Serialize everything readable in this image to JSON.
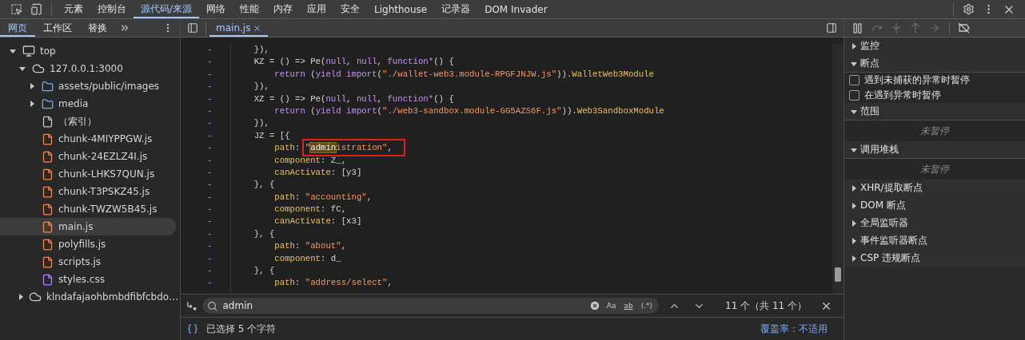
{
  "toolbar": {
    "tabs": [
      {
        "label": "元素",
        "selected": false
      },
      {
        "label": "控制台",
        "selected": false
      },
      {
        "label": "源代码/来源",
        "selected": true
      },
      {
        "label": "网络",
        "selected": false
      },
      {
        "label": "性能",
        "selected": false
      },
      {
        "label": "内存",
        "selected": false
      },
      {
        "label": "应用",
        "selected": false
      },
      {
        "label": "安全",
        "selected": false
      },
      {
        "label": "Lighthouse",
        "selected": false
      },
      {
        "label": "记录器",
        "selected": false
      },
      {
        "label": "DOM Invader",
        "selected": false
      }
    ]
  },
  "navigator": {
    "tabs": [
      {
        "label": "网页",
        "selected": true
      },
      {
        "label": "工作区",
        "selected": false
      },
      {
        "label": "替换",
        "selected": false
      }
    ],
    "tree": [
      {
        "label": "top",
        "kind": "frame",
        "expanded": true,
        "selected": false,
        "children": [
          {
            "label": "127.0.0.1:3000",
            "kind": "origin",
            "expanded": true,
            "selected": false,
            "children": [
              {
                "label": "assets/public/images",
                "kind": "folder",
                "expanded": false,
                "selected": false
              },
              {
                "label": "media",
                "kind": "folder",
                "expanded": false,
                "selected": false
              },
              {
                "label": "（索引）",
                "kind": "document",
                "selected": false
              },
              {
                "label": "chunk-4MIYPPGW.js",
                "kind": "script",
                "selected": false
              },
              {
                "label": "chunk-24EZLZ4I.js",
                "kind": "script",
                "selected": false
              },
              {
                "label": "chunk-LHKS7QUN.js",
                "kind": "script",
                "selected": false
              },
              {
                "label": "chunk-T3PSKZ45.js",
                "kind": "script",
                "selected": false
              },
              {
                "label": "chunk-TWZW5B45.js",
                "kind": "script",
                "selected": false
              },
              {
                "label": "main.js",
                "kind": "script",
                "selected": true
              },
              {
                "label": "polyfills.js",
                "kind": "script",
                "selected": false
              },
              {
                "label": "scripts.js",
                "kind": "script",
                "selected": false
              },
              {
                "label": "styles.css",
                "kind": "stylesheet",
                "selected": false
              }
            ]
          },
          {
            "label": "klndafajaohbmbdfibfcbdo…",
            "kind": "origin",
            "expanded": false,
            "selected": false
          }
        ]
      }
    ]
  },
  "editor": {
    "tabs": [
      {
        "label": "main.js",
        "selected": true
      }
    ],
    "lines": [
      {
        "gutter": "-",
        "tokens": [
          {
            "kind": "plain",
            "text": "    }),"
          }
        ]
      },
      {
        "gutter": "-",
        "tokens": [
          {
            "kind": "plain",
            "text": "    KZ = () => Pe("
          },
          {
            "kind": "keyword",
            "text": "null"
          },
          {
            "kind": "plain",
            "text": ", "
          },
          {
            "kind": "keyword",
            "text": "null"
          },
          {
            "kind": "plain",
            "text": ", "
          },
          {
            "kind": "keyword",
            "text": "function*"
          },
          {
            "kind": "plain",
            "text": "() {"
          }
        ]
      },
      {
        "gutter": "-",
        "tokens": [
          {
            "kind": "keyword",
            "text": "        return"
          },
          {
            "kind": "plain",
            "text": " ("
          },
          {
            "kind": "keyword",
            "text": "yield import"
          },
          {
            "kind": "plain",
            "text": "("
          },
          {
            "kind": "string",
            "text": "\"./wallet-web3.module-RPGFJNJW.js\""
          },
          {
            "kind": "plain",
            "text": "))."
          },
          {
            "kind": "property",
            "text": "WalletWeb3Module"
          }
        ]
      },
      {
        "gutter": "-",
        "tokens": [
          {
            "kind": "plain",
            "text": "    }),"
          }
        ]
      },
      {
        "gutter": "-",
        "tokens": [
          {
            "kind": "plain",
            "text": "    XZ = () => Pe("
          },
          {
            "kind": "keyword",
            "text": "null"
          },
          {
            "kind": "plain",
            "text": ", "
          },
          {
            "kind": "keyword",
            "text": "null"
          },
          {
            "kind": "plain",
            "text": ", "
          },
          {
            "kind": "keyword",
            "text": "function*"
          },
          {
            "kind": "plain",
            "text": "() {"
          }
        ]
      },
      {
        "gutter": "-",
        "tokens": [
          {
            "kind": "keyword",
            "text": "        return"
          },
          {
            "kind": "plain",
            "text": " ("
          },
          {
            "kind": "keyword",
            "text": "yield import"
          },
          {
            "kind": "plain",
            "text": "("
          },
          {
            "kind": "string",
            "text": "\"./web3-sandbox.module-GG5AZS6F.js\""
          },
          {
            "kind": "plain",
            "text": "))."
          },
          {
            "kind": "property",
            "text": "Web3SandboxModule"
          }
        ]
      },
      {
        "gutter": "-",
        "tokens": [
          {
            "kind": "plain",
            "text": "    }),"
          }
        ]
      },
      {
        "gutter": "-",
        "tokens": [
          {
            "kind": "plain",
            "text": "    JZ = [{"
          }
        ]
      },
      {
        "gutter": "-",
        "tokens": [
          {
            "kind": "property",
            "text": "        path"
          },
          {
            "kind": "plain",
            "text": ": "
          },
          {
            "kind": "string",
            "text": "\"",
            "boxed": true
          },
          {
            "kind": "match",
            "text": "admin",
            "boxed": true
          },
          {
            "kind": "string",
            "text": "istration\"",
            "boxed": true
          },
          {
            "kind": "plain",
            "text": ",",
            "boxed": true
          }
        ]
      },
      {
        "gutter": "-",
        "tokens": [
          {
            "kind": "property",
            "text": "        component"
          },
          {
            "kind": "plain",
            "text": ": Z_,"
          }
        ]
      },
      {
        "gutter": "-",
        "tokens": [
          {
            "kind": "property",
            "text": "        canActivate"
          },
          {
            "kind": "plain",
            "text": ": [y3]"
          }
        ]
      },
      {
        "gutter": "-",
        "tokens": [
          {
            "kind": "plain",
            "text": "    }, {"
          }
        ]
      },
      {
        "gutter": "-",
        "tokens": [
          {
            "kind": "property",
            "text": "        path"
          },
          {
            "kind": "plain",
            "text": ": "
          },
          {
            "kind": "string",
            "text": "\"accounting\""
          },
          {
            "kind": "plain",
            "text": ","
          }
        ]
      },
      {
        "gutter": "-",
        "tokens": [
          {
            "kind": "property",
            "text": "        component"
          },
          {
            "kind": "plain",
            "text": ": fC,"
          }
        ]
      },
      {
        "gutter": "-",
        "tokens": [
          {
            "kind": "property",
            "text": "        canActivate"
          },
          {
            "kind": "plain",
            "text": ": [x3]"
          }
        ]
      },
      {
        "gutter": "-",
        "tokens": [
          {
            "kind": "plain",
            "text": "    }, {"
          }
        ]
      },
      {
        "gutter": "-",
        "tokens": [
          {
            "kind": "property",
            "text": "        path"
          },
          {
            "kind": "plain",
            "text": ": "
          },
          {
            "kind": "string",
            "text": "\"about\""
          },
          {
            "kind": "plain",
            "text": ","
          }
        ]
      },
      {
        "gutter": "-",
        "tokens": [
          {
            "kind": "property",
            "text": "        component"
          },
          {
            "kind": "plain",
            "text": ": d_"
          }
        ]
      },
      {
        "gutter": "-",
        "tokens": [
          {
            "kind": "plain",
            "text": "    }, {"
          }
        ]
      },
      {
        "gutter": "-",
        "tokens": [
          {
            "kind": "property",
            "text": "        path"
          },
          {
            "kind": "plain",
            "text": ": "
          },
          {
            "kind": "string",
            "text": "\"address/select\""
          },
          {
            "kind": "plain",
            "text": ","
          }
        ]
      }
    ]
  },
  "search": {
    "value": "admin",
    "toggles": [
      {
        "label": "Aa",
        "selected": false
      },
      {
        "label": "ab",
        "selected": false
      },
      {
        "label": "(.*)",
        "selected": false
      }
    ],
    "count": "11 个（共 11 个）"
  },
  "status": {
    "selection": "已选择 5 个字符",
    "coverage": "覆盖率：不适用"
  },
  "debugger": {
    "sections": [
      {
        "title": "监控",
        "expanded": false
      },
      {
        "title": "断点",
        "expanded": true,
        "items": [
          {
            "kind": "checkbox",
            "label": "遇到未捕获的异常时暂停",
            "checked": false
          },
          {
            "kind": "checkbox",
            "label": "在遇到异常时暂停",
            "checked": false
          }
        ]
      },
      {
        "title": "范围",
        "expanded": true,
        "items": [
          {
            "kind": "empty",
            "label": "未暂停"
          }
        ]
      },
      {
        "title": "调用堆栈",
        "expanded": true,
        "items": [
          {
            "kind": "empty",
            "label": "未暂停"
          }
        ]
      },
      {
        "title": "XHR/提取断点",
        "expanded": false
      },
      {
        "title": "DOM 断点",
        "expanded": false
      },
      {
        "title": "全局监听器",
        "expanded": false
      },
      {
        "title": "事件监听器断点",
        "expanded": false
      },
      {
        "title": "CSP 违规断点",
        "expanded": false
      }
    ]
  }
}
